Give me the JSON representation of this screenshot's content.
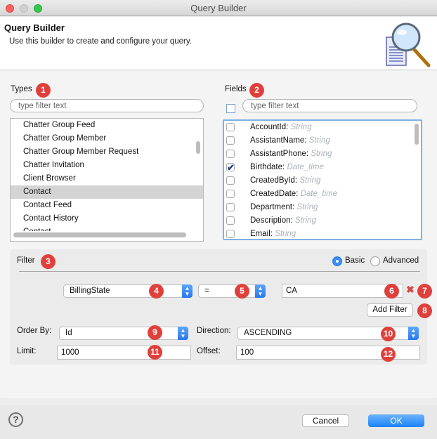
{
  "window": {
    "title": "Query Builder"
  },
  "header": {
    "title": "Query Builder",
    "description": "Use this builder to create and configure your query.",
    "icon": "magnifier-document-icon"
  },
  "types": {
    "label": "Types",
    "badge": "1",
    "filter_placeholder": "type filter text",
    "items": [
      {
        "label": "Chatter Group Feed",
        "selected": false
      },
      {
        "label": "Chatter Group Member",
        "selected": false
      },
      {
        "label": "Chatter Group Member Request",
        "selected": false
      },
      {
        "label": "Chatter Invitation",
        "selected": false
      },
      {
        "label": "Client Browser",
        "selected": false
      },
      {
        "label": "Contact",
        "selected": true
      },
      {
        "label": "Contact Feed",
        "selected": false
      },
      {
        "label": "Contact History",
        "selected": false
      },
      {
        "label": "Contact...",
        "selected": false
      }
    ]
  },
  "fields": {
    "label": "Fields",
    "badge": "2",
    "filter_placeholder": "type filter text",
    "select_all_checked": false,
    "items": [
      {
        "name": "AccountId:",
        "type": "String",
        "checked": false
      },
      {
        "name": "AssistantName:",
        "type": "String",
        "checked": false
      },
      {
        "name": "AssistantPhone:",
        "type": "String",
        "checked": false
      },
      {
        "name": "Birthdate:",
        "type": "Date_time",
        "checked": true
      },
      {
        "name": "CreatedById:",
        "type": "String",
        "checked": false
      },
      {
        "name": "CreatedDate:",
        "type": "Date_time",
        "checked": false
      },
      {
        "name": "Department:",
        "type": "String",
        "checked": false
      },
      {
        "name": "Description:",
        "type": "String",
        "checked": false
      },
      {
        "name": "Email:",
        "type": "String",
        "checked": false
      }
    ]
  },
  "filter": {
    "label": "Filter",
    "badge": "3",
    "mode_basic": "Basic",
    "mode_advanced": "Advanced",
    "selected_mode": "Basic",
    "field_value": "BillingState",
    "field_badge": "4",
    "operator_value": "=",
    "operator_badge": "5",
    "value": "CA",
    "value_badge": "6",
    "delete_badge": "7",
    "add_filter_label": "Add Filter",
    "add_filter_badge": "8"
  },
  "options": {
    "order_by_label": "Order By:",
    "order_by_value": "Id",
    "order_by_badge": "9",
    "direction_label": "Direction:",
    "direction_value": "ASCENDING",
    "direction_badge": "10",
    "limit_label": "Limit:",
    "limit_value": "1000",
    "limit_badge": "11",
    "offset_label": "Offset:",
    "offset_value": "100",
    "offset_badge": "12"
  },
  "footer": {
    "help": "?",
    "cancel_label": "Cancel",
    "ok_label": "OK"
  }
}
